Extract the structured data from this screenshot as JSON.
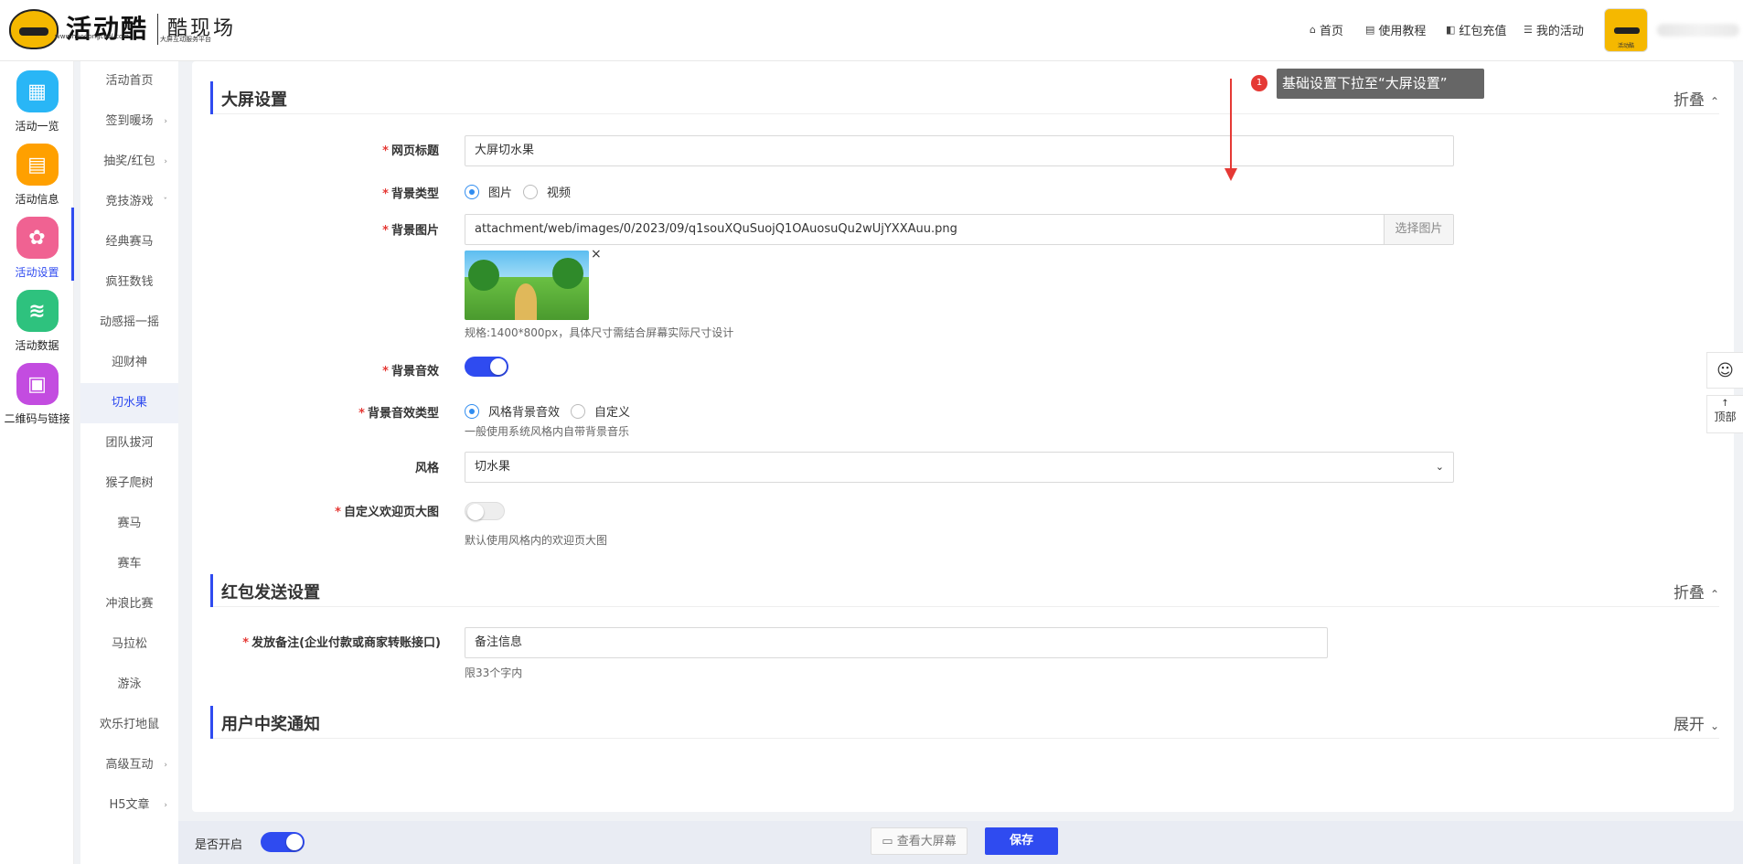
{
  "header": {
    "logo_title": "活动酷",
    "logo_url": "www.huodongcool.com",
    "logo_subtitle": "酷现场",
    "logo_tagline": "大屏互动服务平台",
    "nav": [
      {
        "icon": "home-icon",
        "glyph": "⌂",
        "label": "首页"
      },
      {
        "icon": "doc-icon",
        "glyph": "▤",
        "label": "使用教程"
      },
      {
        "icon": "wallet-icon",
        "glyph": "◧",
        "label": "红包充值"
      },
      {
        "icon": "list-icon",
        "glyph": "☰",
        "label": "我的活动"
      }
    ],
    "avatar_caption": "活动酷"
  },
  "leftnav": [
    {
      "label": "活动一览",
      "icon": "grid-icon",
      "glyph": "▦",
      "color": "#29b6f6"
    },
    {
      "label": "活动信息",
      "icon": "document-icon",
      "glyph": "▤",
      "color": "#ffa000"
    },
    {
      "label": "活动设置",
      "icon": "gear-icon",
      "glyph": "✿",
      "color": "#f06292",
      "active": true
    },
    {
      "label": "活动数据",
      "icon": "database-icon",
      "glyph": "≋",
      "color": "#2ec27e"
    },
    {
      "label": "二维码与链接",
      "icon": "qrcode-icon",
      "glyph": "▣",
      "color": "#c34ce0"
    }
  ],
  "subnav": [
    {
      "label": "活动首页",
      "chev": ""
    },
    {
      "label": "签到暖场",
      "chev": "›"
    },
    {
      "label": "抽奖/红包",
      "chev": "›"
    },
    {
      "label": "竞技游戏",
      "chev": "ˇ"
    },
    {
      "label": "经典赛马",
      "chev": ""
    },
    {
      "label": "疯狂数钱",
      "chev": ""
    },
    {
      "label": "动感摇一摇",
      "chev": ""
    },
    {
      "label": "迎财神",
      "chev": ""
    },
    {
      "label": "切水果",
      "chev": "",
      "active": true
    },
    {
      "label": "团队拔河",
      "chev": ""
    },
    {
      "label": "猴子爬树",
      "chev": ""
    },
    {
      "label": "赛马",
      "chev": ""
    },
    {
      "label": "赛车",
      "chev": ""
    },
    {
      "label": "冲浪比赛",
      "chev": ""
    },
    {
      "label": "马拉松",
      "chev": ""
    },
    {
      "label": "游泳",
      "chev": ""
    },
    {
      "label": "欢乐打地鼠",
      "chev": ""
    },
    {
      "label": "高级互动",
      "chev": "›"
    },
    {
      "label": "H5文章",
      "chev": "›"
    }
  ],
  "screen_section": {
    "title": "大屏设置",
    "toggle": "折叠",
    "toggle_arrow": "⌃",
    "page_title_label": "网页标题",
    "page_title_value": "大屏切水果",
    "bg_type_label": "背景类型",
    "bg_type_options": [
      "图片",
      "视频"
    ],
    "bg_image_label": "背景图片",
    "bg_image_value": "attachment/web/images/0/2023/09/q1souXQuSuojQ1OAuosuQu2wUjYXXAuu.png",
    "bg_image_button": "选择图片",
    "bg_image_hint": "规格:1400*800px，具体尺寸需结合屏幕实际尺寸设计",
    "bg_sound_label": "背景音效",
    "bg_sound_type_label": "背景音效类型",
    "bg_sound_type_options": [
      "风格背景音效",
      "自定义"
    ],
    "bg_sound_type_hint": "一般使用系统风格内自带背景音乐",
    "style_label": "风格",
    "style_value": "切水果",
    "welcome_label": "自定义欢迎页大图",
    "welcome_hint": "默认使用风格内的欢迎页大图"
  },
  "redpacket_section": {
    "title": "红包发送设置",
    "toggle": "折叠",
    "toggle_arrow": "⌃",
    "remark_label": "发放备注(企业付款或商家转账接口)",
    "remark_value": "备注信息",
    "remark_hint": "限33个字内"
  },
  "notify_section": {
    "title": "用户中奖通知",
    "toggle": "展开",
    "toggle_arrow": "⌄"
  },
  "annotation": {
    "badge": "1",
    "text": "基础设置下拉至“大屏设置”"
  },
  "side_buttons": {
    "qq_glyph": "☺",
    "top_glyph": "↑",
    "top_label": "顶部"
  },
  "bottom": {
    "enable_label": "是否开启",
    "preview_label": "查看大屏幕",
    "preview_glyph": "▭",
    "save_label": "保存"
  },
  "close_glyph": "×",
  "required_mark": "*",
  "colors": {
    "accent": "#2f4bf0",
    "required": "#e53935",
    "annotation": "#e53935"
  }
}
